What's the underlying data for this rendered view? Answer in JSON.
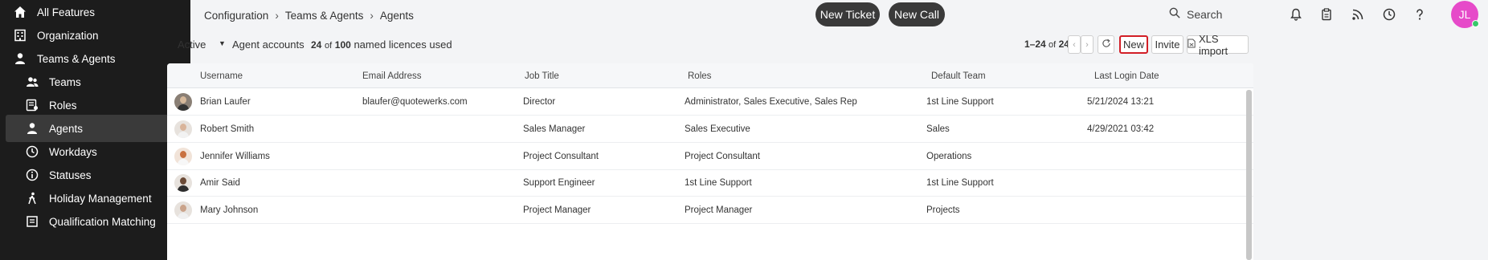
{
  "sidebar": {
    "items": [
      {
        "label": "All Features",
        "icon": "home-icon"
      },
      {
        "label": "Organization",
        "icon": "building-icon"
      },
      {
        "label": "Teams & Agents",
        "icon": "person-icon"
      },
      {
        "label": "Teams",
        "icon": "group-icon"
      },
      {
        "label": "Roles",
        "icon": "roles-icon"
      },
      {
        "label": "Agents",
        "icon": "person-icon"
      },
      {
        "label": "Workdays",
        "icon": "clock-icon"
      },
      {
        "label": "Statuses",
        "icon": "info-icon"
      },
      {
        "label": "Holiday Management",
        "icon": "walking-icon"
      },
      {
        "label": "Qualification Matching",
        "icon": "matching-icon"
      }
    ]
  },
  "header": {
    "breadcrumb": [
      "Configuration",
      "Teams & Agents",
      "Agents"
    ],
    "new_ticket_label": "New Ticket",
    "new_call_label": "New Call",
    "search_label": "Search",
    "avatar_initials": "JL"
  },
  "toolbar": {
    "filter_value": "Active",
    "accounts_label": "Agent accounts",
    "licences_used": "24",
    "licences_of": "of",
    "licences_total": "100",
    "licences_suffix": "named licences used",
    "range": "1–24",
    "range_of": "of",
    "range_total": "24",
    "new_label": "New",
    "invite_label": "Invite",
    "xls_label": "XLS import"
  },
  "table": {
    "columns": [
      "Username",
      "Email Address",
      "Job Title",
      "Roles",
      "Default Team",
      "Last Login Date"
    ],
    "rows": [
      {
        "username": "Brian Laufer",
        "email": "blaufer@quotewerks.com",
        "job_title": "Director",
        "roles": "Administrator, Sales Executive, Sales Rep",
        "team": "1st Line Support",
        "last_login": "5/21/2024 13:21"
      },
      {
        "username": "Robert Smith",
        "email": "",
        "job_title": "Sales Manager",
        "roles": "Sales Executive",
        "team": "Sales",
        "last_login": "4/29/2021 03:42"
      },
      {
        "username": "Jennifer Williams",
        "email": "",
        "job_title": "Project Consultant",
        "roles": "Project Consultant",
        "team": "Operations",
        "last_login": ""
      },
      {
        "username": "Amir Said",
        "email": "",
        "job_title": "Support Engineer",
        "roles": "1st Line Support",
        "team": "1st Line Support",
        "last_login": ""
      },
      {
        "username": "Mary Johnson",
        "email": "",
        "job_title": "Project Manager",
        "roles": "Project Manager",
        "team": "Projects",
        "last_login": ""
      }
    ]
  },
  "colors": {
    "sidebar_bg": "#1c1c1c",
    "accent_pink": "#e64ac9",
    "highlight_red": "#d21e26"
  }
}
